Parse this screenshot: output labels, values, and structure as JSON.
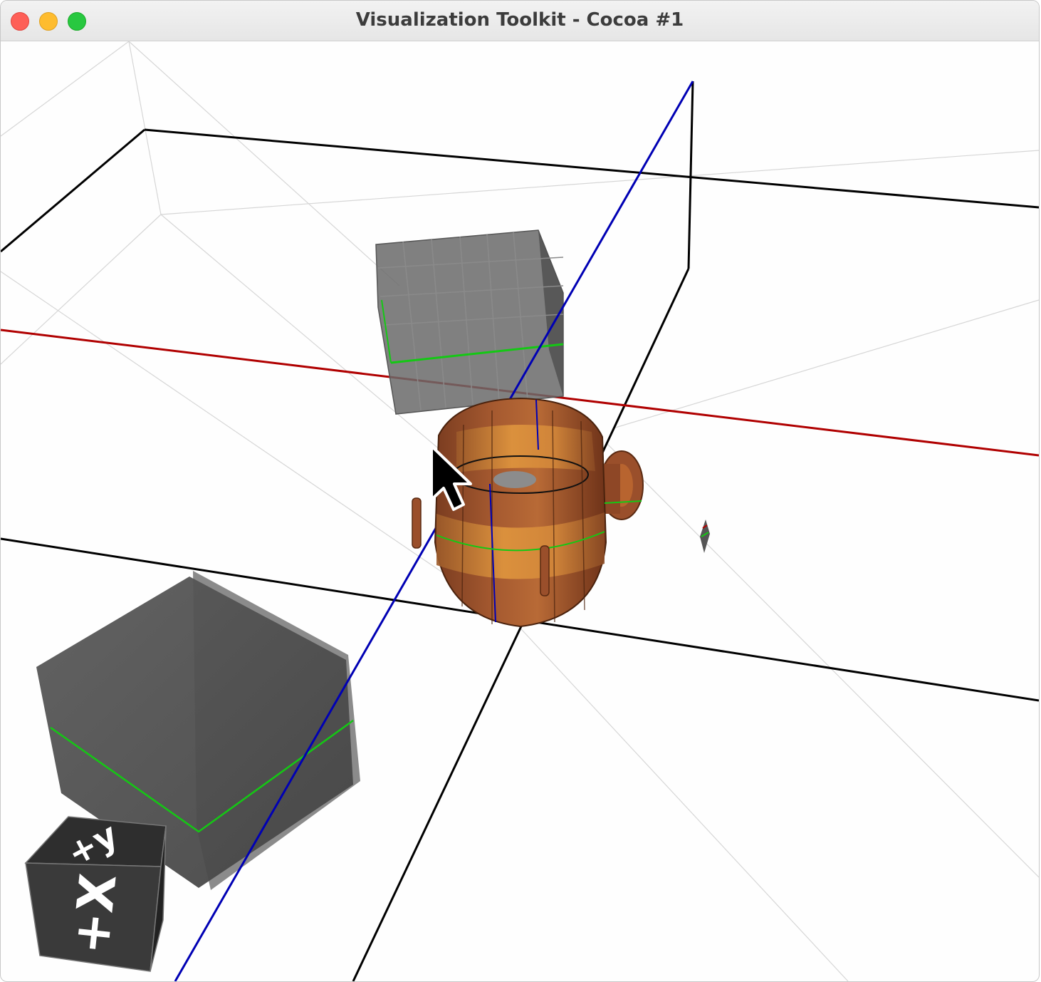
{
  "window": {
    "title": "Visualization Toolkit - Cocoa #1"
  },
  "orientation_cube": {
    "face_front": "+X",
    "face_top": "+y"
  },
  "colors": {
    "x_axis": "#b00000",
    "y_axis": "#0000b4",
    "bounding_lines": "#000000",
    "mesh_lines": "#d0d0d0",
    "barrel_dark": "#8a4a28",
    "barrel_light": "#c77a3a",
    "box_gray": "#555555",
    "highlight_green": "#14c814"
  }
}
